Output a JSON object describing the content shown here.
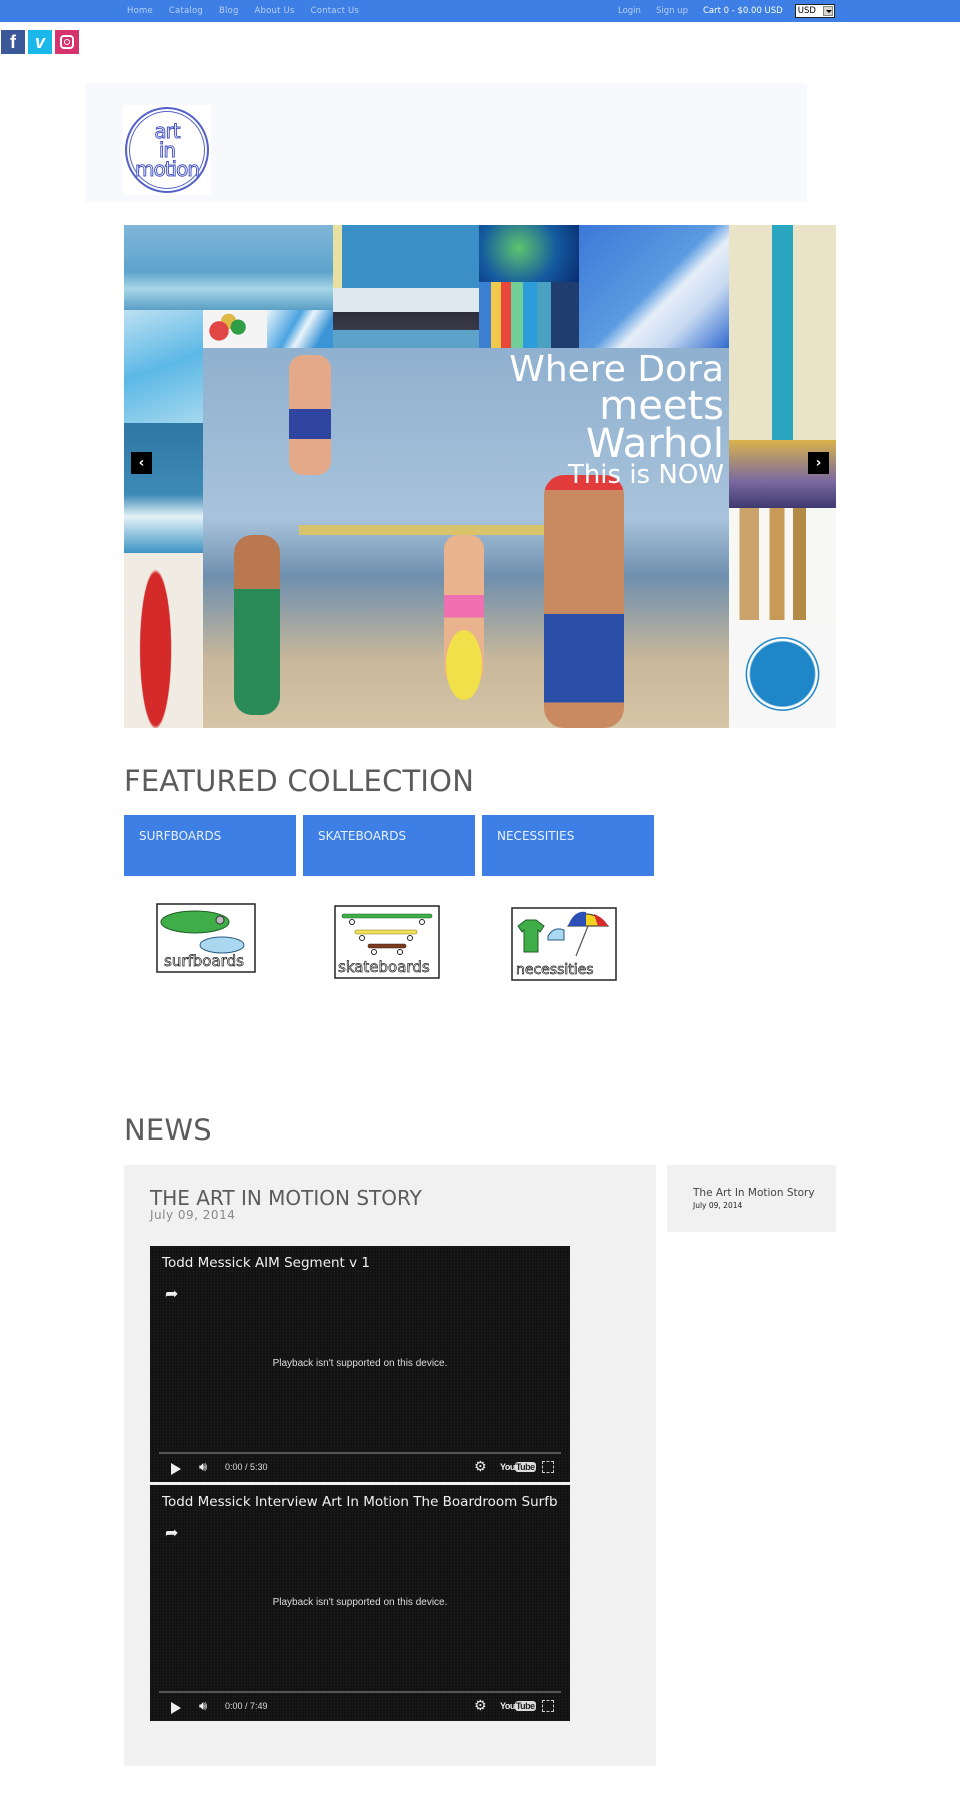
{
  "topbar": {
    "nav": [
      "Home",
      "Catalog",
      "Blog",
      "About Us",
      "Contact Us"
    ],
    "login": "Login",
    "signup": "Sign up",
    "cart": "Cart 0 - $0.00 USD",
    "currency": "USD",
    "bg_color": "#3d7fe4"
  },
  "social": {
    "facebook": "f",
    "vimeo": "v"
  },
  "logo": {
    "line1": "art",
    "line2": "in",
    "line3": "motion"
  },
  "hero": {
    "slogan_l1": "Where Dora",
    "slogan_l2": "meets Warhol",
    "slogan_l3": "This is NOW",
    "prev": "‹",
    "next": "›"
  },
  "featured": {
    "title": "FEATURED COLLECTION",
    "collections": [
      {
        "label": "SURFBOARDS",
        "image_caption": "surfboards"
      },
      {
        "label": "SKATEBOARDS",
        "image_caption": "skateboards"
      },
      {
        "label": "NECESSITIES",
        "image_caption": "necessities"
      }
    ]
  },
  "news": {
    "title": "NEWS",
    "article": {
      "title": "THE ART IN MOTION STORY",
      "date": "July 09, 2014",
      "videos": [
        {
          "title": "Todd Messick AIM Segment v 1",
          "message": "Playback isn't supported on this device.",
          "time": "0:00 / 5:30"
        },
        {
          "title": "Todd Messick Interview Art In Motion The Boardroom Surfb",
          "message": "Playback isn't supported on this device.",
          "time": "0:00 / 7:49"
        }
      ]
    },
    "sidebar": {
      "title": "The Art In Motion Story",
      "date": "July 09, 2014"
    }
  },
  "video_player": {
    "youtube_label_a": "You",
    "youtube_label_b": "Tube"
  }
}
